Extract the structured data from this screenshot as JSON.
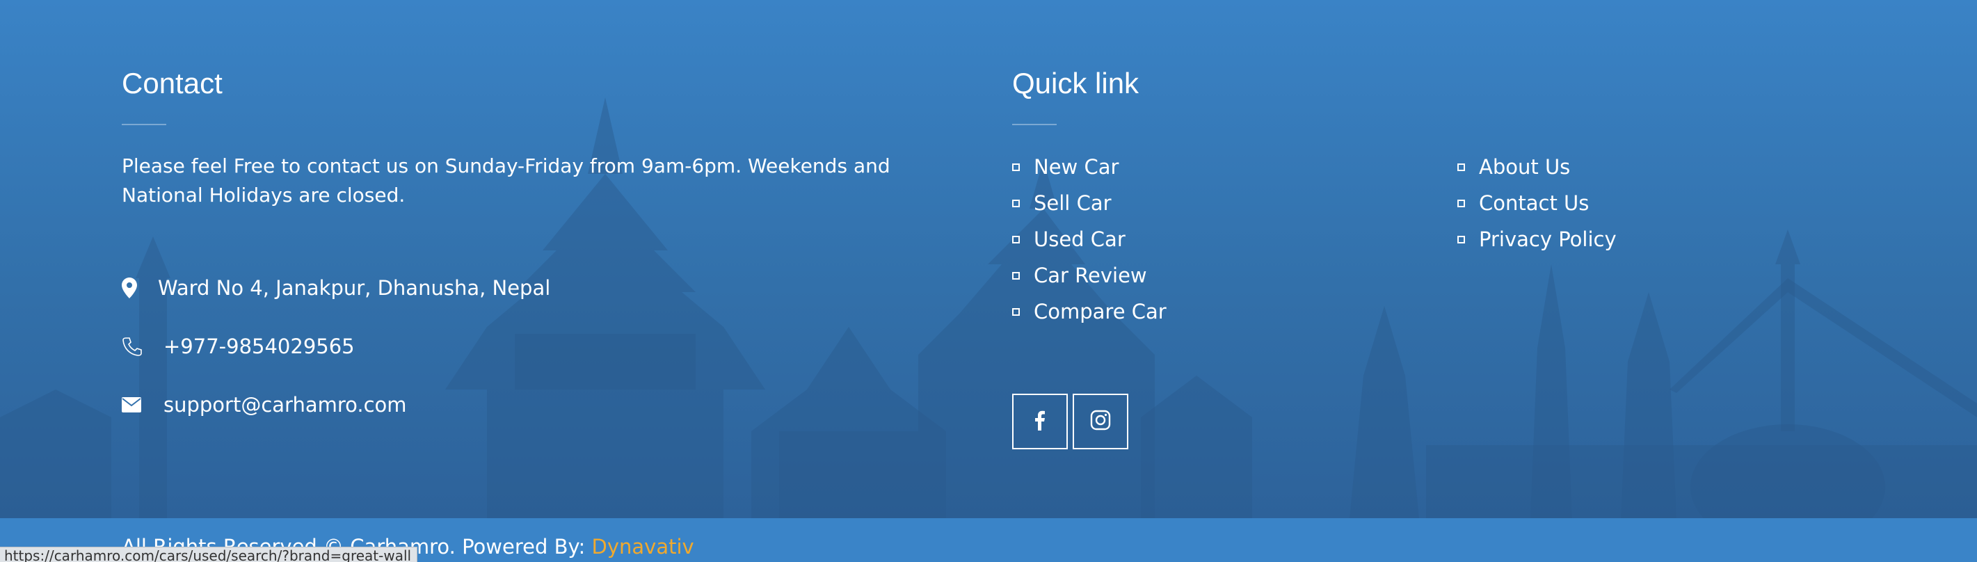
{
  "contact": {
    "title": "Contact",
    "description": "Please feel Free to contact us on Sunday-Friday from 9am-6pm. Weekends and National Holidays are closed.",
    "address": "Ward No 4, Janakpur, Dhanusha, Nepal",
    "phone": "+977-9854029565",
    "email": "support@carhamro.com",
    "icons": [
      "map-marker-icon",
      "phone-icon",
      "envelope-icon"
    ]
  },
  "quick_links": {
    "title": "Quick link",
    "column1": [
      {
        "label": "New Car"
      },
      {
        "label": "Sell Car"
      },
      {
        "label": "Used Car"
      },
      {
        "label": "Car Review"
      },
      {
        "label": "Compare Car"
      }
    ],
    "column2": [
      {
        "label": "About Us"
      },
      {
        "label": "Contact Us"
      },
      {
        "label": "Privacy Policy"
      }
    ]
  },
  "social": [
    {
      "name": "facebook",
      "icon": "facebook-icon"
    },
    {
      "name": "instagram",
      "icon": "instagram-icon"
    }
  ],
  "footer": {
    "copyright": "All Rights Reserved © Carhamro. Powered By: ",
    "powered_by": "Dynavativ"
  },
  "status_bar": {
    "url": "https://carhamro.com/cars/used/search/?brand=great-wall"
  },
  "colors": {
    "background": "#3a82c5",
    "accent": "#f0a92e",
    "text": "#ffffff"
  }
}
